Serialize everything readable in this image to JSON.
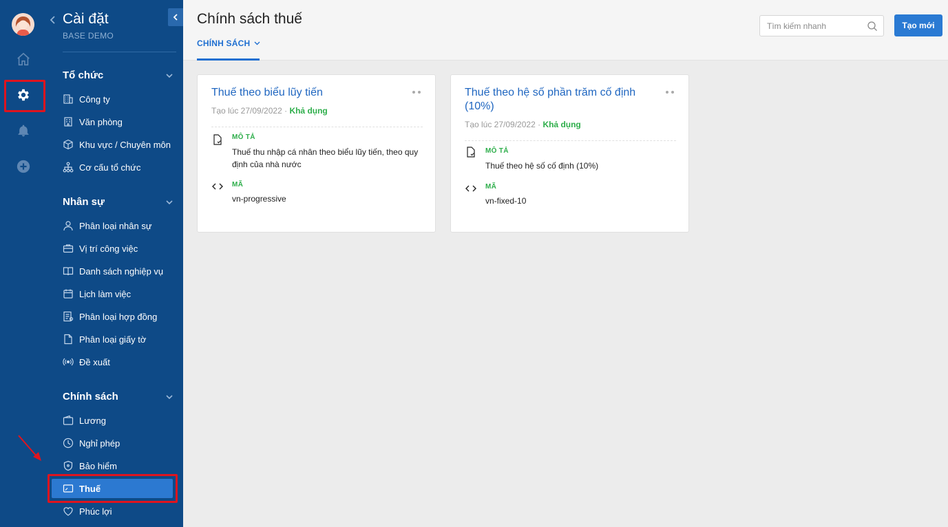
{
  "sidebar": {
    "title": "Cài đặt",
    "subtitle": "BASE DEMO",
    "sections": [
      {
        "title": "Tổ chức",
        "items": [
          "Công ty",
          "Văn phòng",
          "Khu vực / Chuyên môn",
          "Cơ cấu tổ chức"
        ]
      },
      {
        "title": "Nhân sự",
        "items": [
          "Phân loại nhân sự",
          "Vị trí công việc",
          "Danh sách nghiệp vụ",
          "Lịch làm việc",
          "Phân loại hợp đồng",
          "Phân loại giấy tờ",
          "Đề xuất"
        ]
      },
      {
        "title": "Chính sách",
        "items": [
          "Lương",
          "Nghỉ phép",
          "Bảo hiểm",
          "Thuế",
          "Phúc lợi"
        ]
      }
    ],
    "active_item": "Thuế"
  },
  "header": {
    "title": "Chính sách thuế",
    "tab_label": "CHÍNH SÁCH",
    "search_placeholder": "Tìm kiếm nhanh",
    "create_label": "Tạo mới"
  },
  "cards": [
    {
      "title": "Thuế theo biểu lũy tiến",
      "created": "Tạo lúc 27/09/2022",
      "separator": "·",
      "status": "Khả dụng",
      "desc_label": "MÔ TẢ",
      "desc": "Thuế thu nhập cá nhân theo biểu lũy tiến, theo quy định của nhà nước",
      "code_label": "MÃ",
      "code": "vn-progressive"
    },
    {
      "title": "Thuế theo hệ số phần trăm cố định (10%)",
      "created": "Tạo lúc 27/09/2022",
      "separator": "·",
      "status": "Khả dụng",
      "desc_label": "MÔ TẢ",
      "desc": "Thuế theo hệ số cố định (10%)",
      "code_label": "MÃ",
      "code": "vn-fixed-10"
    }
  ],
  "colors": {
    "sidebar_bg": "#0e4a87",
    "active_bg": "#2c79d1",
    "accent": "#1f6fd1",
    "status_green": "#2eae4b",
    "highlight_red": "#e0141e"
  }
}
